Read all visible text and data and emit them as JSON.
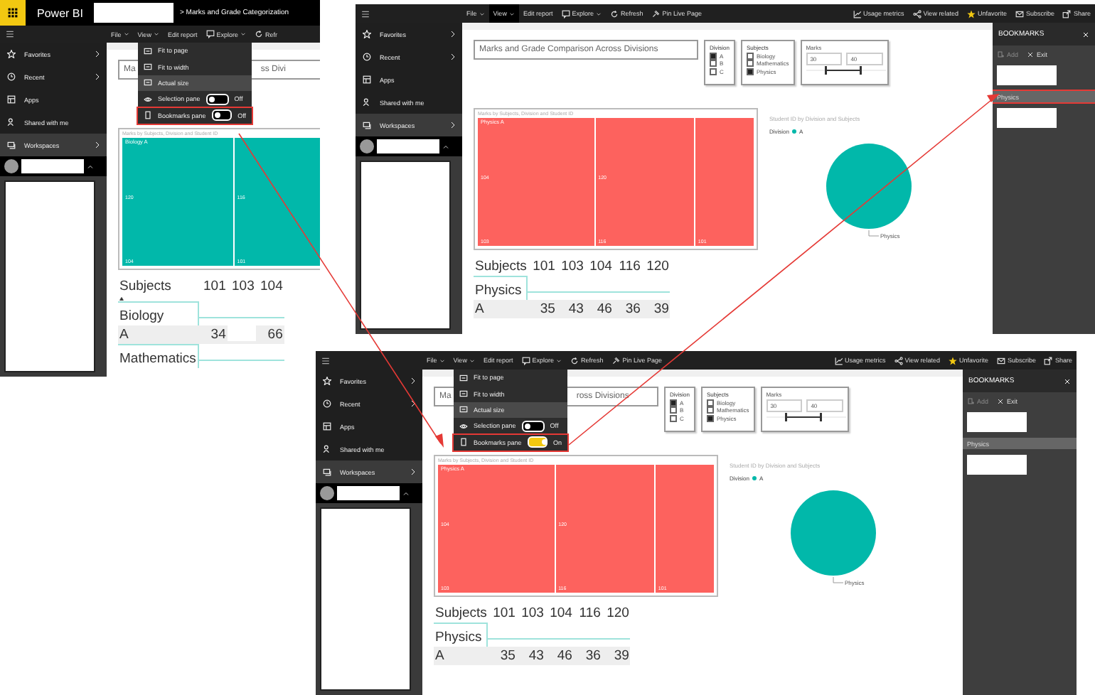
{
  "screenshots": [
    {
      "header": {
        "app_name": "Power BI",
        "breadcrumb": "> Marks and Grade Categorization"
      },
      "toolbar": {
        "left": [
          {
            "label": "File",
            "kind": "menu",
            "selected": false
          },
          {
            "label": "View",
            "kind": "menu",
            "selected": false
          },
          {
            "label": "Edit report",
            "kind": "text",
            "selected": false
          },
          {
            "label": "Explore",
            "kind": "explore",
            "selected": false
          },
          {
            "label": "Refr",
            "kind": "refresh",
            "selected": false
          }
        ]
      },
      "nav": [
        {
          "label": "Favorites",
          "kind": "star",
          "expandable": true,
          "selected": false
        },
        {
          "label": "Recent",
          "kind": "clock",
          "expandable": true,
          "selected": false
        },
        {
          "label": "Apps",
          "kind": "apps",
          "expandable": false,
          "selected": false
        },
        {
          "label": "Shared with me",
          "kind": "shared",
          "expandable": false,
          "selected": false
        },
        {
          "label": "Workspaces",
          "kind": "workspaces",
          "expandable": true,
          "selected": true
        }
      ],
      "view_menu": {
        "items": [
          {
            "label": "Fit to page",
            "kind": "item",
            "selected": false
          },
          {
            "label": "Fit to width",
            "kind": "item",
            "selected": false
          },
          {
            "label": "Actual size",
            "kind": "item",
            "selected": true
          },
          {
            "label": "Selection pane",
            "kind": "toggle",
            "on": false,
            "reading": "Off",
            "highlighted": false
          },
          {
            "label": "Bookmarks pane",
            "kind": "toggle",
            "on": false,
            "reading": "Off",
            "highlighted": true
          }
        ]
      },
      "report": {
        "title_parts": [
          "Ma",
          "ss Divi"
        ],
        "treemap": {
          "title": "Marks by Subjects, Division and Student ID",
          "group_label": "Biology A",
          "color": "#01b8aa",
          "tiles": [
            "120",
            "104",
            "116",
            "101"
          ]
        },
        "table": {
          "columns": [
            "Subjects",
            "101",
            "103",
            "104"
          ],
          "sortable": true,
          "groups": [
            {
              "name": "Biology",
              "rows": [
                {
                  "label": "A",
                  "cells": [
                    {
                      "kind": "value",
                      "text": "34"
                    },
                    {
                      "kind": "blank"
                    },
                    {
                      "kind": "value",
                      "text": "66"
                    }
                  ]
                }
              ]
            },
            {
              "name": "Mathematics"
            }
          ]
        }
      }
    },
    {
      "toolbar": {
        "left": [
          {
            "label": "File",
            "kind": "menu",
            "selected": false
          },
          {
            "label": "View",
            "kind": "menu",
            "selected": true
          },
          {
            "label": "Edit report",
            "kind": "text",
            "selected": false
          },
          {
            "label": "Explore",
            "kind": "explore",
            "selected": false
          },
          {
            "label": "Refresh",
            "kind": "refresh",
            "selected": false
          },
          {
            "label": "Pin Live Page",
            "kind": "pin",
            "selected": false
          }
        ],
        "right": [
          {
            "label": "Usage metrics",
            "kind": "metrics",
            "selected": false
          },
          {
            "label": "View related",
            "kind": "related",
            "selected": false
          },
          {
            "label": "Unfavorite",
            "kind": "star",
            "selected": false
          },
          {
            "label": "Subscribe",
            "kind": "subscribe",
            "selected": false
          },
          {
            "label": "Share",
            "kind": "share",
            "selected": false
          }
        ]
      },
      "nav": [
        {
          "label": "Favorites",
          "kind": "star",
          "expandable": true,
          "selected": false
        },
        {
          "label": "Recent",
          "kind": "clock",
          "expandable": true,
          "selected": false
        },
        {
          "label": "Apps",
          "kind": "apps",
          "expandable": false,
          "selected": false
        },
        {
          "label": "Shared with me",
          "kind": "shared",
          "expandable": false,
          "selected": false
        },
        {
          "label": "Workspaces",
          "kind": "workspaces",
          "expandable": true,
          "selected": true
        }
      ],
      "report": {
        "title_parts": [
          "Marks and Grade Comparison Across Divisions"
        ],
        "division_slicer": {
          "title": "Division",
          "items": [
            {
              "label": "A",
              "checked": true
            },
            {
              "label": "B",
              "checked": false
            },
            {
              "label": "C",
              "checked": false
            }
          ]
        },
        "subjects_slicer": {
          "title": "Subjects",
          "items": [
            {
              "label": "Biology",
              "checked": false
            },
            {
              "label": "Mathematics",
              "checked": false
            },
            {
              "label": "Physics",
              "checked": true
            }
          ]
        },
        "marks_slicer": {
          "title": "Marks",
          "from": "30",
          "to": "40"
        },
        "treemap": {
          "title": "Marks by Subjects, Division and Student ID",
          "group_label": "Physics A",
          "color": "#fd625e",
          "tiles": [
            "104",
            "103",
            "120",
            "116",
            "101"
          ]
        },
        "pie": {
          "title": "Student ID by Division and Subjects",
          "legend_title": "Division",
          "legend_items": [
            {
              "label": "A",
              "color": "#01b8aa"
            }
          ],
          "slice_label": "Physics"
        },
        "table": {
          "columns": [
            "Subjects",
            "101",
            "103",
            "104",
            "116",
            "120"
          ],
          "groups": [
            {
              "name": "Physics",
              "rows": [
                {
                  "label": "A",
                  "cells": [
                    {
                      "kind": "value",
                      "text": "35"
                    },
                    {
                      "kind": "value",
                      "text": "43"
                    },
                    {
                      "kind": "value",
                      "text": "46"
                    },
                    {
                      "kind": "value",
                      "text": "36"
                    },
                    {
                      "kind": "value",
                      "text": "39"
                    }
                  ]
                }
              ]
            }
          ]
        }
      },
      "bookmarks": {
        "title": "BOOKMARKS",
        "actions": [
          {
            "label": "Add",
            "kind": "add",
            "disabled": true
          },
          {
            "label": "Exit",
            "kind": "exit",
            "disabled": false
          }
        ],
        "items": [
          {
            "kind": "redacted",
            "selected": false,
            "highlighted": false
          },
          {
            "kind": "bookmark",
            "label": "Physics",
            "selected": true,
            "highlighted": true
          },
          {
            "kind": "redacted",
            "selected": false,
            "highlighted": false
          }
        ]
      }
    },
    {
      "toolbar": {
        "left": [
          {
            "label": "File",
            "kind": "menu",
            "selected": false
          },
          {
            "label": "View",
            "kind": "menu",
            "selected": false
          },
          {
            "label": "Edit report",
            "kind": "text",
            "selected": false
          },
          {
            "label": "Explore",
            "kind": "explore",
            "selected": false
          },
          {
            "label": "Refresh",
            "kind": "refresh",
            "selected": false
          },
          {
            "label": "Pin Live Page",
            "kind": "pin",
            "selected": false
          }
        ],
        "right": [
          {
            "label": "Usage metrics",
            "kind": "metrics",
            "selected": false
          },
          {
            "label": "View related",
            "kind": "related",
            "selected": false
          },
          {
            "label": "Unfavorite",
            "kind": "star",
            "selected": false
          },
          {
            "label": "Subscribe",
            "kind": "subscribe",
            "selected": false
          },
          {
            "label": "Share",
            "kind": "share",
            "selected": false
          }
        ]
      },
      "nav": [
        {
          "label": "Favorites",
          "kind": "star",
          "expandable": true,
          "selected": false
        },
        {
          "label": "Recent",
          "kind": "clock",
          "expandable": true,
          "selected": false
        },
        {
          "label": "Apps",
          "kind": "apps",
          "expandable": false,
          "selected": false
        },
        {
          "label": "Shared with me",
          "kind": "shared",
          "expandable": false,
          "selected": false
        },
        {
          "label": "Workspaces",
          "kind": "workspaces",
          "expandable": true,
          "selected": true
        }
      ],
      "view_menu": {
        "items": [
          {
            "label": "Fit to page",
            "kind": "item",
            "selected": false
          },
          {
            "label": "Fit to width",
            "kind": "item",
            "selected": false
          },
          {
            "label": "Actual size",
            "kind": "item",
            "selected": true
          },
          {
            "label": "Selection pane",
            "kind": "toggle",
            "on": false,
            "reading": "Off",
            "highlighted": false
          },
          {
            "label": "Bookmarks pane",
            "kind": "toggle",
            "on": true,
            "reading": "On",
            "highlighted": true
          }
        ]
      },
      "report": {
        "title_parts": [
          "Ma",
          "ross Divisions"
        ],
        "division_slicer": {
          "title": "Division",
          "items": [
            {
              "label": "A",
              "checked": true
            },
            {
              "label": "B",
              "checked": false
            },
            {
              "label": "C",
              "checked": false
            }
          ]
        },
        "subjects_slicer": {
          "title": "Subjects",
          "items": [
            {
              "label": "Biology",
              "checked": false
            },
            {
              "label": "Mathematics",
              "checked": false
            },
            {
              "label": "Physics",
              "checked": true
            }
          ]
        },
        "marks_slicer": {
          "title": "Marks",
          "from": "30",
          "to": "40"
        },
        "treemap": {
          "title": "Marks by Subjects, Division and Student ID",
          "group_label": "Physics A",
          "color": "#fd625e",
          "tiles": [
            "104",
            "103",
            "120",
            "116",
            "101"
          ]
        },
        "pie": {
          "title": "Student ID by Division and Subjects",
          "legend_title": "Division",
          "legend_items": [
            {
              "label": "A",
              "color": "#01b8aa"
            }
          ],
          "slice_label": "Physics"
        },
        "table": {
          "columns": [
            "Subjects",
            "101",
            "103",
            "104",
            "116",
            "120"
          ],
          "groups": [
            {
              "name": "Physics",
              "rows": [
                {
                  "label": "A",
                  "cells": [
                    {
                      "kind": "value",
                      "text": "35"
                    },
                    {
                      "kind": "value",
                      "text": "43"
                    },
                    {
                      "kind": "value",
                      "text": "46"
                    },
                    {
                      "kind": "value",
                      "text": "36"
                    },
                    {
                      "kind": "value",
                      "text": "39"
                    }
                  ]
                }
              ]
            }
          ]
        }
      },
      "bookmarks": {
        "title": "BOOKMARKS",
        "actions": [
          {
            "label": "Add",
            "kind": "add",
            "disabled": true
          },
          {
            "label": "Exit",
            "kind": "exit",
            "disabled": false
          }
        ],
        "items": [
          {
            "kind": "redacted",
            "selected": false,
            "highlighted": false
          },
          {
            "kind": "bookmark",
            "label": "Physics",
            "selected": true,
            "highlighted": false
          },
          {
            "kind": "redacted",
            "selected": false,
            "highlighted": false
          }
        ]
      }
    }
  ]
}
